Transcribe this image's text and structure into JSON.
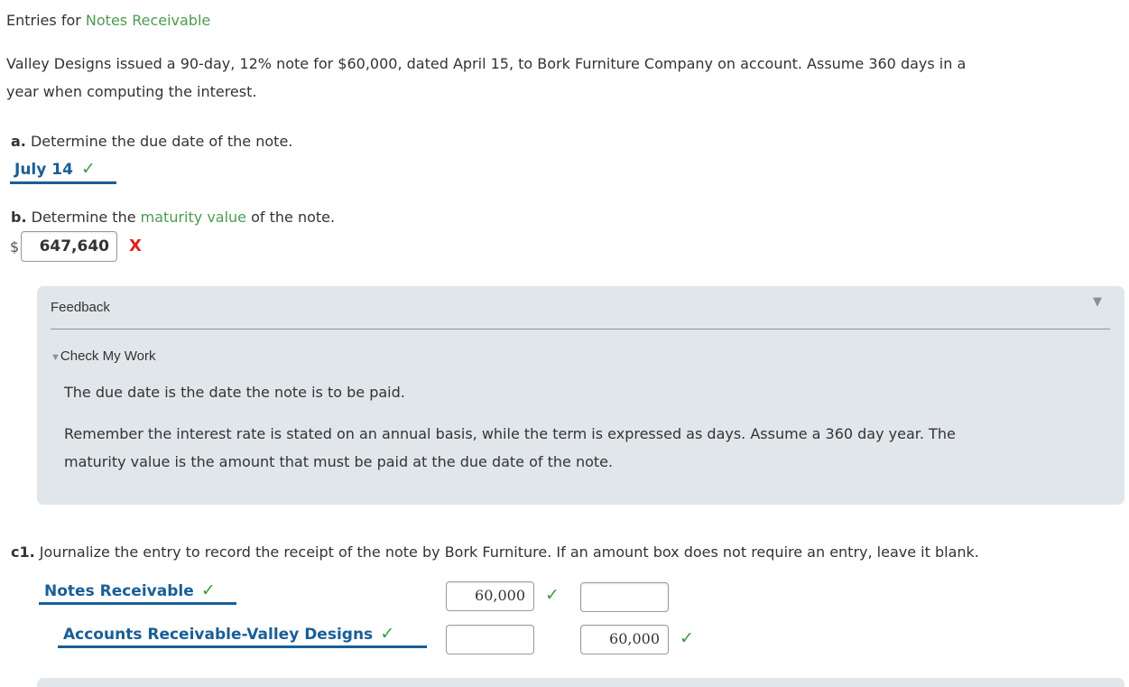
{
  "heading": {
    "prefix": "Entries for ",
    "term": "Notes Receivable"
  },
  "problem": {
    "line1": "Valley Designs issued a 90-day, 12% note for $60,000, dated April 15, to Bork Furniture Company on account. Assume 360 days in a",
    "line2": "year when computing the interest."
  },
  "part_a": {
    "label": "a.",
    "question": "Determine the due date of the note.",
    "answer": "July 14",
    "status_icon": "✓"
  },
  "part_b": {
    "label": "b.",
    "question_pre": "Determine the ",
    "question_term": "maturity value",
    "question_post": " of the note.",
    "currency": "$",
    "answer": "647,640",
    "status_icon": "X"
  },
  "feedback": {
    "title": "Feedback",
    "toggle_icon": "▼",
    "check_label": "Check My Work",
    "check_icon": "▼",
    "para1": "The due date is the date the note is to be paid.",
    "para2_line1": "Remember the interest rate is stated on an annual basis, while the term is expressed as days. Assume a 360 day year. The",
    "para2_line2": "maturity value is the amount that must be paid at the due date of the note."
  },
  "part_c1": {
    "label": "c1.",
    "question": "Journalize the entry to record the receipt of the note by Bork Furniture. If an amount box does not require an entry, leave it blank.",
    "entries": [
      {
        "account": "Notes Receivable",
        "account_status": "✓",
        "debit": "60,000",
        "debit_status": "✓",
        "credit": "",
        "credit_status": ""
      },
      {
        "account": "Accounts Receivable-Valley Designs",
        "account_status": "✓",
        "debit": "",
        "debit_status": "",
        "credit": "60,000",
        "credit_status": "✓"
      }
    ]
  }
}
